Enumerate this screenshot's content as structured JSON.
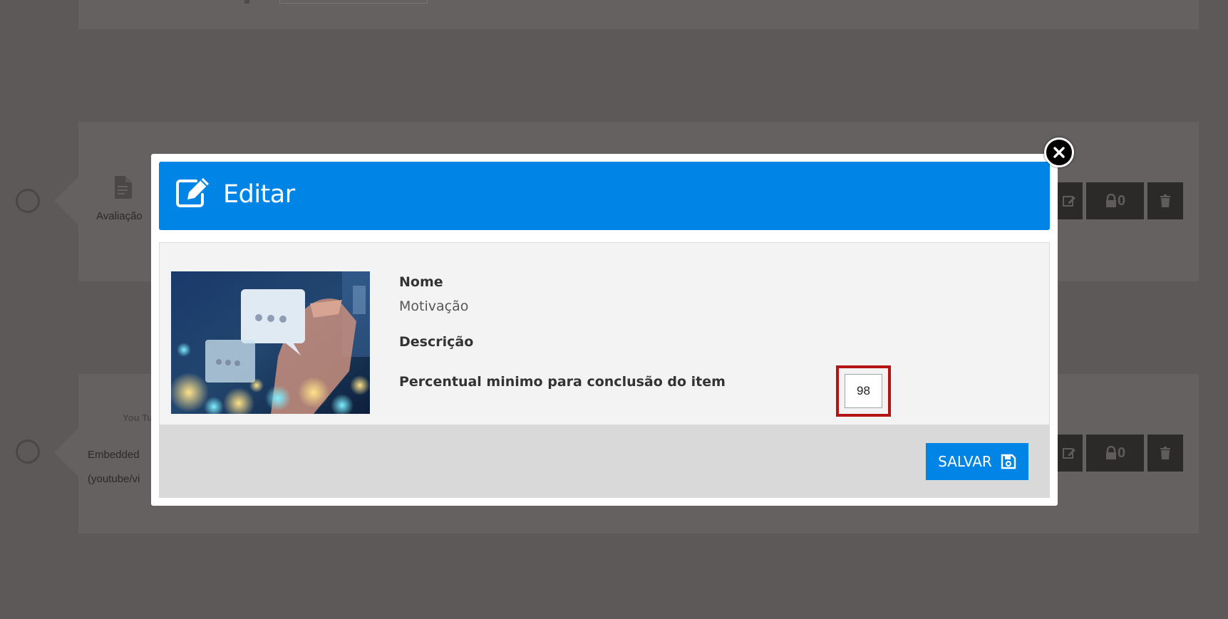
{
  "background": {
    "items": [
      {
        "type_label": "Avaliação"
      },
      {
        "type_label_line1": "Embedded",
        "type_label_line2": "(youtube/vi",
        "icon_text": "You Tube"
      }
    ],
    "lock_count": "0"
  },
  "modal": {
    "title": "Editar",
    "fields": {
      "name_label": "Nome",
      "name_value": "Motivação",
      "description_label": "Descrição",
      "min_percent_label": "Percentual minimo para conclusão do item",
      "min_percent_value": "98"
    },
    "save_label": "SALVAR"
  },
  "colors": {
    "header_blue": "#0085e6",
    "highlight_red": "#b51414",
    "overlay": "#5c5958"
  }
}
